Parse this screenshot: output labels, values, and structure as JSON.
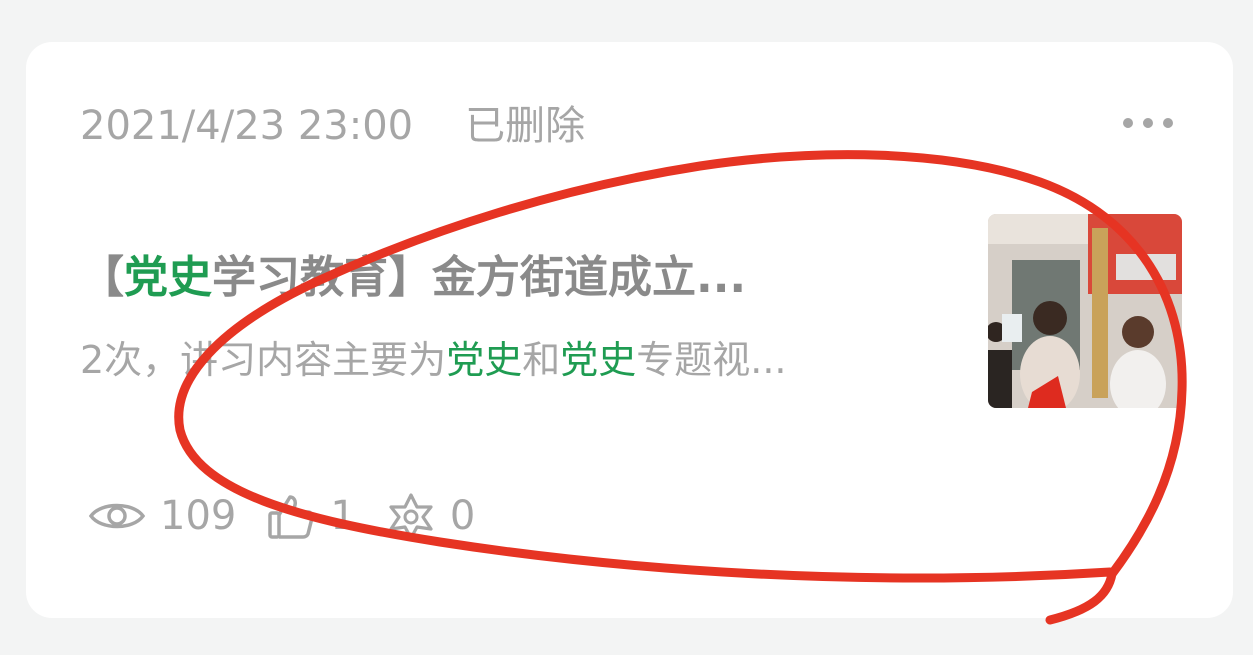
{
  "post": {
    "date": "2021/4/23 23:00",
    "status": "已删除",
    "title_prefix": "【",
    "title_hl": "党史",
    "title_rest": "学习教育】金方街道成立...",
    "snippet_a": "2次，讲习内容主要为",
    "snippet_hl1": "党史",
    "snippet_b": "和",
    "snippet_hl2": "党史",
    "snippet_c": "专题视...",
    "thumbnail_icon": "photo-thumbnail"
  },
  "stats": {
    "views": "109",
    "likes": "1",
    "shares": "0"
  },
  "icons": {
    "views": "eye-icon",
    "likes": "thumbs-up-icon",
    "shares": "share-icon",
    "more": "more-dots-icon"
  },
  "colors": {
    "highlight": "#1f9c52",
    "annotation": "#e63423",
    "muted_text": "#a6a6a6"
  }
}
